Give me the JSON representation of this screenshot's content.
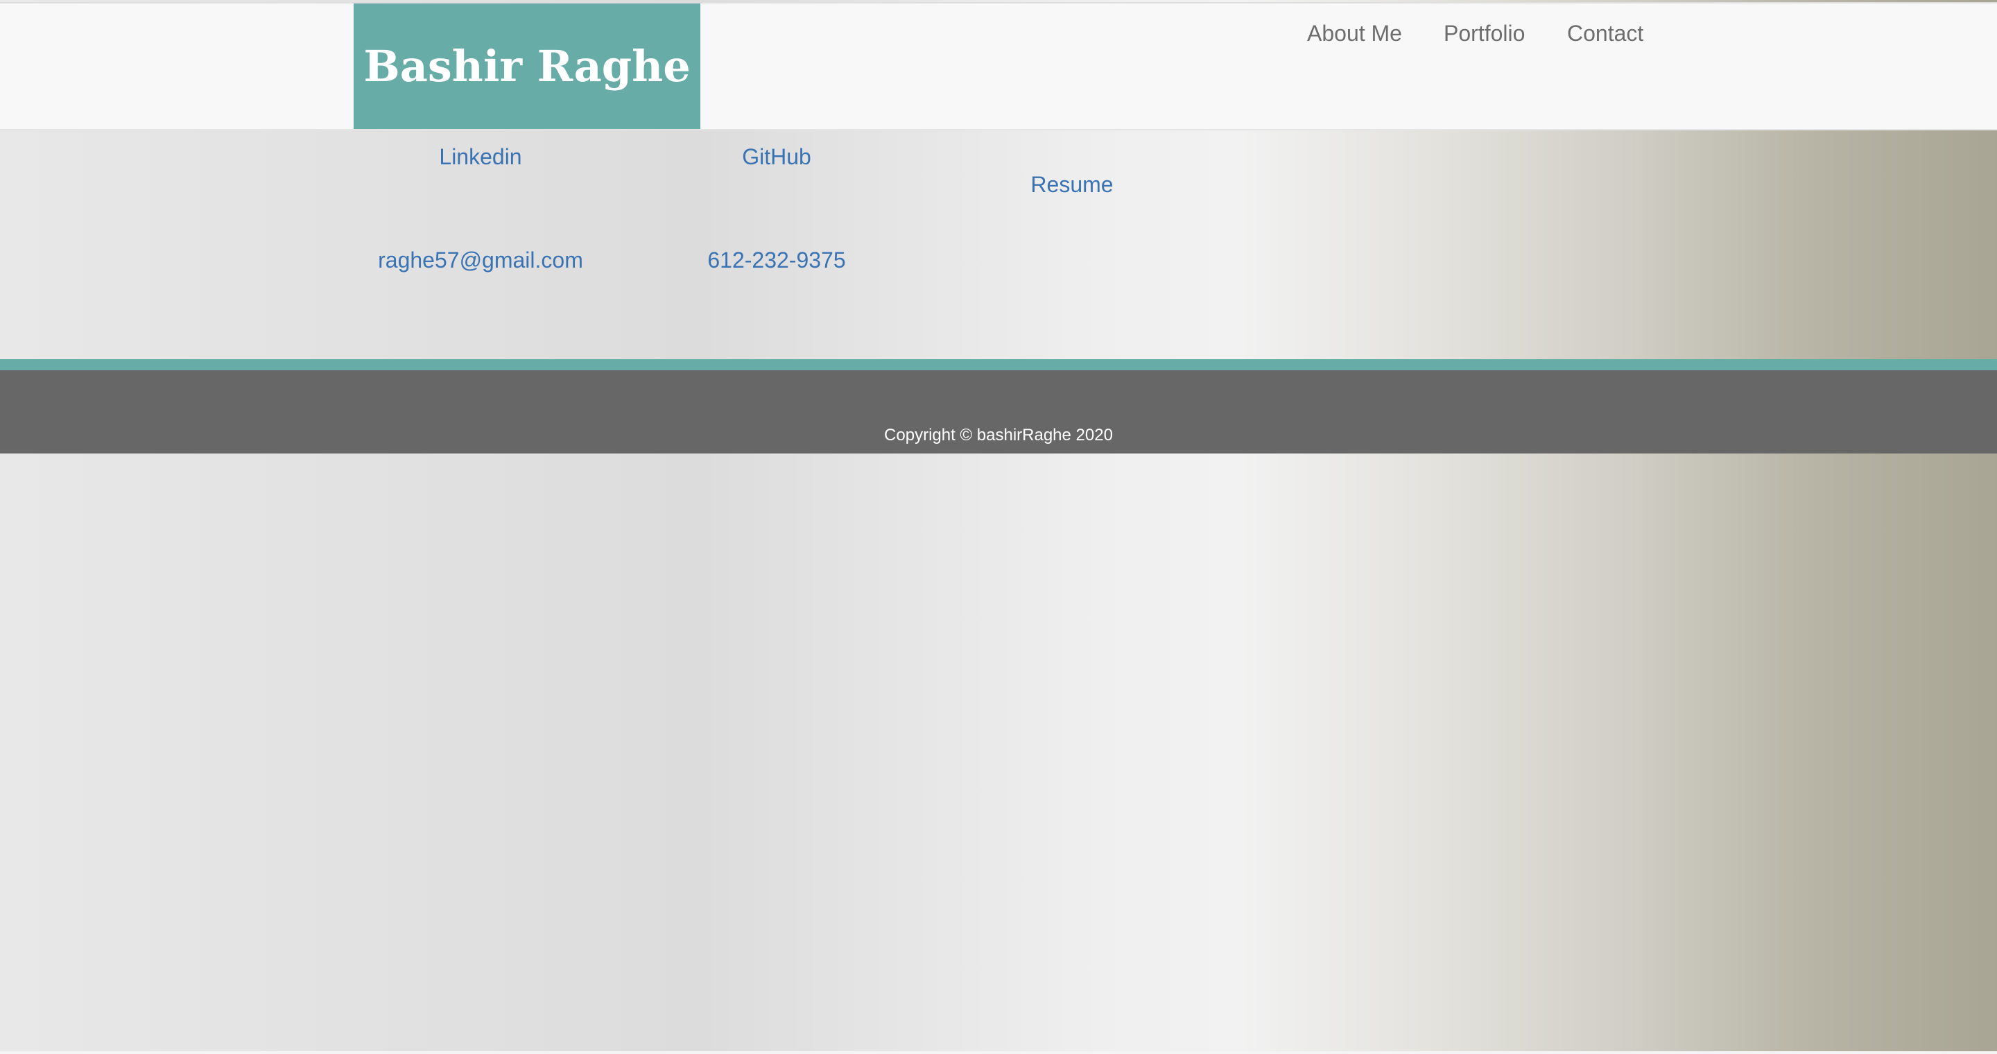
{
  "header": {
    "brand_name": "Bashir Raghe",
    "nav": {
      "about": "About Me",
      "portfolio": "Portfolio",
      "contact": "Contact"
    }
  },
  "contact_links": {
    "linkedin": "Linkedin",
    "github": "GitHub",
    "resume": "Resume",
    "email": "raghe57@gmail.com",
    "phone": "612-232-9375"
  },
  "footer": {
    "copyright": "Copyright © bashirRaghe 2020"
  },
  "colors": {
    "accent": "#67aca6",
    "link": "#3a73b4",
    "footer_bg": "#676767",
    "nav_text": "#6d6d6d"
  }
}
